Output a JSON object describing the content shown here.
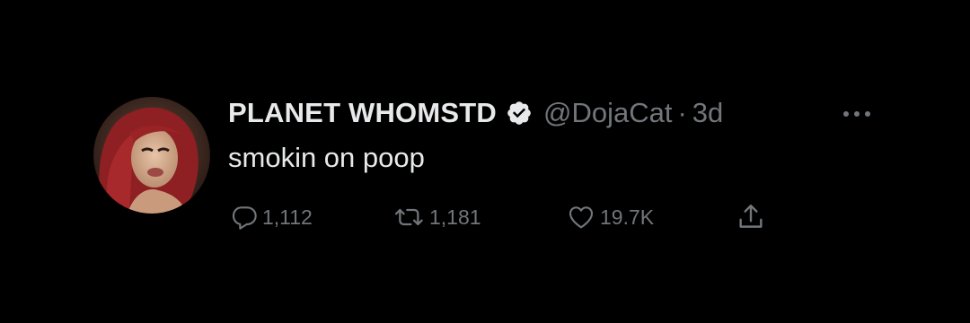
{
  "tweet": {
    "display_name": "PLANET WHOMSTD",
    "handle": "@DojaCat",
    "separator": "·",
    "time": "3d",
    "text": "smokin on poop",
    "verified": true
  },
  "actions": {
    "reply_count": "1,112",
    "retweet_count": "1,181",
    "like_count": "19.7K"
  },
  "icons": {
    "reply": "reply-icon",
    "retweet": "retweet-icon",
    "like": "heart-icon",
    "share": "share-icon",
    "more": "more-icon",
    "verified": "verified-badge-icon"
  },
  "colors": {
    "background": "#000000",
    "primary_text": "#e7e9ea",
    "secondary_text": "#71767b",
    "verified_badge": "#e7e9ea"
  }
}
